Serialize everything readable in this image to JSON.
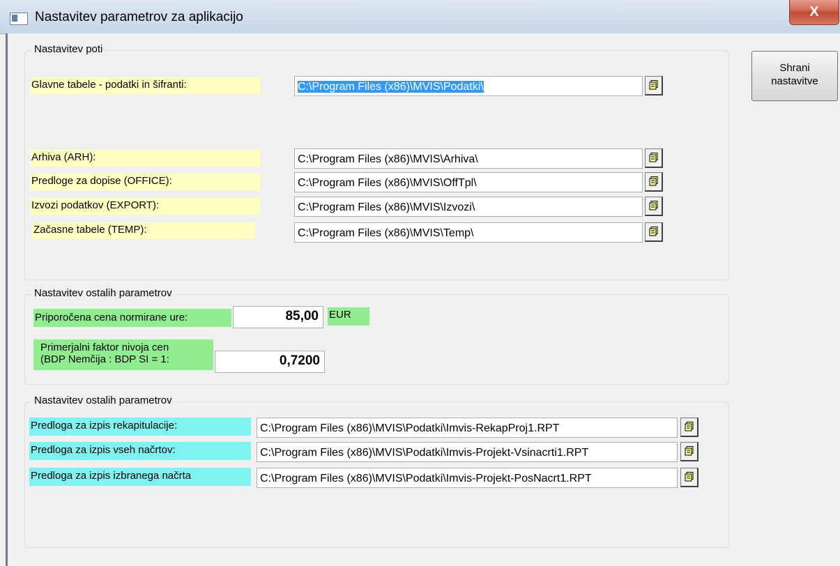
{
  "window": {
    "title": "Nastavitev parametrov za aplikacijo",
    "close_label": "X"
  },
  "save_button": {
    "label_line1": "Shrani",
    "label_line2": "nastavitve"
  },
  "paths_group": {
    "legend": "Nastavitev poti",
    "main": {
      "label": "Glavne tabele - podatki in šifranti:",
      "value": "C:\\Program Files (x86)\\MVIS\\Podatki\\"
    },
    "archive": {
      "label": "Arhiva (ARH):",
      "value": "C:\\Program Files (x86)\\MVIS\\Arhiva\\"
    },
    "office": {
      "label": "Predloge za dopise (OFFICE):",
      "value": "C:\\Program Files (x86)\\MVIS\\OffTpl\\"
    },
    "export": {
      "label": "Izvozi podatkov (EXPORT):",
      "value": "C:\\Program Files (x86)\\MVIS\\Izvozi\\"
    },
    "temp": {
      "label": "Začasne tabele (TEMP):",
      "value": "C:\\Program Files (x86)\\MVIS\\Temp\\"
    }
  },
  "params_group": {
    "legend": "Nastavitev ostalih parametrov",
    "price": {
      "label": "Priporočena cena normirane ure:",
      "value": "85,00",
      "unit": "EUR"
    },
    "factor": {
      "label_line1": "Primerjalni faktor nivoja cen",
      "label_line2": "(BDP Nemčija : BDP SI = 1:",
      "value": "0,7200"
    }
  },
  "reports_group": {
    "legend": "Nastavitev ostalih parametrov",
    "recap": {
      "label": "Predloga za izpis rekapitulacije:",
      "value": "C:\\Program Files (x86)\\MVIS\\Podatki\\Imvis-RekapProj1.RPT"
    },
    "all_drafts": {
      "label": "Predloga za izpis vseh načrtov:",
      "value": "C:\\Program Files (x86)\\MVIS\\Podatki\\Imvis-Projekt-Vsinacrti1.RPT"
    },
    "selected_draft": {
      "label": "Predloga za izpis izbranega načrta",
      "value": "C:\\Program Files (x86)\\MVIS\\Podatki\\Imvis-Projekt-PosNacrt1.RPT"
    }
  },
  "colors": {
    "path_label_bg": "#ffffc0",
    "param_label_bg": "#90ee90",
    "report_label_bg": "#7ff2f2",
    "selection": "#3399ff"
  },
  "icons": {
    "browse": "folder-browse-icon",
    "window": "app-window-icon",
    "close": "close-icon"
  }
}
